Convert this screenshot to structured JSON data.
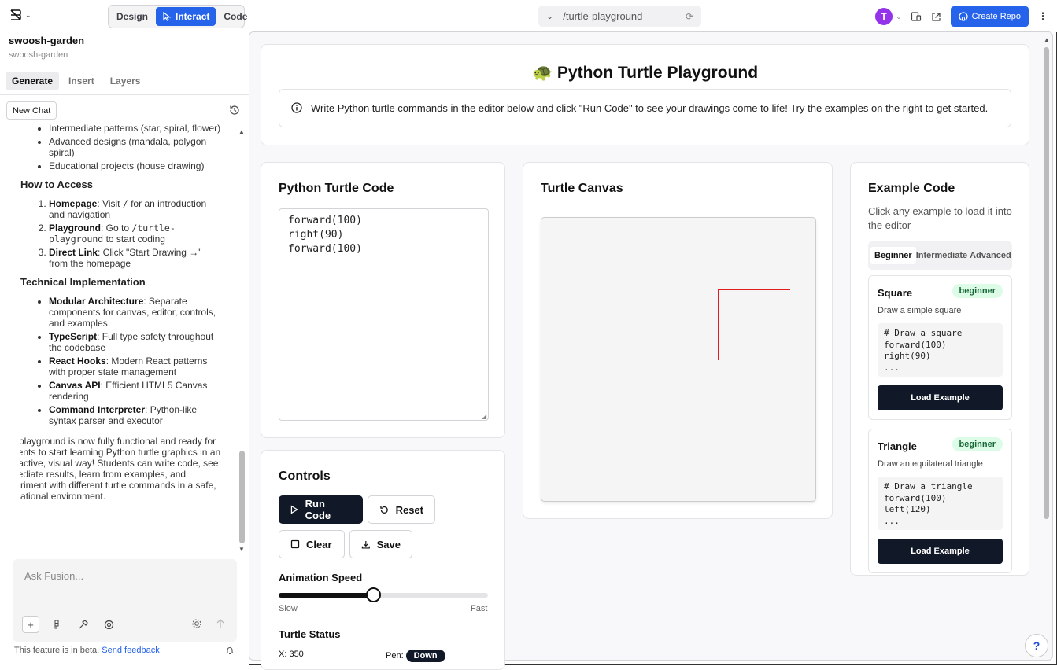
{
  "topbar": {
    "modes": [
      "Design",
      "Interact",
      "Code"
    ],
    "active_mode": "Interact",
    "url": "/turtle-playground",
    "avatar_initial": "T",
    "create_repo_label": "Create Repo"
  },
  "sidebar": {
    "project_name": "swoosh-garden",
    "project_sub": "swoosh-garden",
    "tabs": [
      "Generate",
      "Insert",
      "Layers"
    ],
    "new_chat_label": "New Chat",
    "chat": {
      "features": [
        "Intermediate patterns (star, spiral, flower)",
        "Advanced designs (mandala, polygon spiral)",
        "Educational projects (house drawing)"
      ],
      "how_to_access_heading": "How to Access",
      "access": [
        {
          "bold": "Homepage",
          "text": ": Visit ",
          "code": "/",
          "rest": " for an introduction and navigation"
        },
        {
          "bold": "Playground",
          "text": ": Go to ",
          "code": "/turtle-playground",
          "rest": " to start coding"
        },
        {
          "bold": "Direct Link",
          "text": ": Click \"Start Drawing →\" from the homepage",
          "code": "",
          "rest": ""
        }
      ],
      "tech_heading": "Technical Implementation",
      "tech": [
        {
          "bold": "Modular Architecture",
          "text": ": Separate components for canvas, editor, controls, and examples"
        },
        {
          "bold": "TypeScript",
          "text": ": Full type safety throughout the codebase"
        },
        {
          "bold": "React Hooks",
          "text": ": Modern React patterns with proper state management"
        },
        {
          "bold": "Canvas API",
          "text": ": Efficient HTML5 Canvas rendering"
        },
        {
          "bold": "Command Interpreter",
          "text": ": Python-like syntax parser and executor"
        }
      ],
      "final": "The playground is now fully functional and ready for students to start learning Python turtle graphics in an interactive, visual way! Students can write code, see immediate results, learn from examples, and experiment with different turtle commands in a safe, educational environment."
    },
    "ask_placeholder": "Ask Fusion...",
    "beta_text": "This feature is in beta.",
    "feedback_link": "Send feedback"
  },
  "page": {
    "title": "🐢 Python Turtle Playground",
    "info": "Write Python turtle commands in the editor below and click \"Run Code\" to see your drawings come to life! Try the examples on the right to get started."
  },
  "editor": {
    "title": "Python Turtle Code",
    "code": "forward(100)\nright(90)\nforward(100)"
  },
  "controls": {
    "title": "Controls",
    "run_label": "Run Code",
    "reset_label": "Reset",
    "clear_label": "Clear",
    "save_label": "Save",
    "speed_label": "Animation Speed",
    "speed_value": 0.45,
    "slow_label": "Slow",
    "fast_label": "Fast",
    "status_title": "Turtle Status",
    "x_text": "X: 350",
    "pen_label": "Pen:",
    "pen_state": "Down"
  },
  "canvas": {
    "title": "Turtle Canvas",
    "line_color": "#e11d1d"
  },
  "examples": {
    "title": "Example Code",
    "subtitle": "Click any example to load it into the editor",
    "tabs": [
      "Beginner",
      "Intermediate",
      "Advanced"
    ],
    "active_tab": "Beginner",
    "items": [
      {
        "name": "Square",
        "level": "beginner",
        "desc": "Draw a simple square",
        "code": "# Draw a square\nforward(100)\nright(90)\n...",
        "load_label": "Load Example"
      },
      {
        "name": "Triangle",
        "level": "beginner",
        "desc": "Draw an equilateral triangle",
        "code": "# Draw a triangle\nforward(100)\nleft(120)\n...",
        "load_label": "Load Example"
      }
    ]
  },
  "colors": {
    "accent": "#2563eb",
    "dark_button": "#111827",
    "badge_bg": "#dcfce7",
    "badge_text": "#166534"
  }
}
